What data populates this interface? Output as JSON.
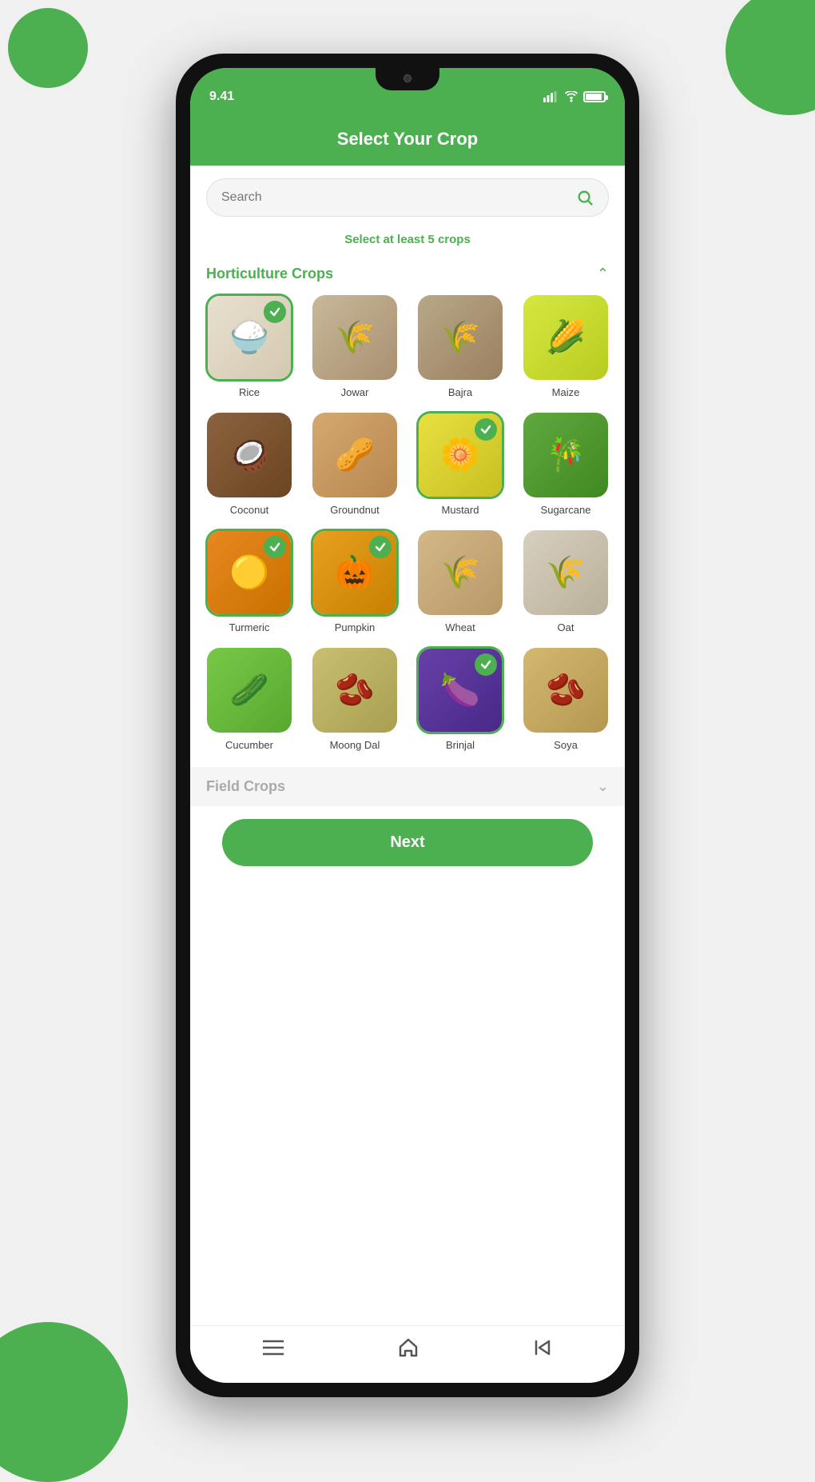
{
  "app": {
    "title": "Select Your Crop",
    "time": "9.41",
    "search_placeholder": "Search",
    "info_text": "Select at least ",
    "info_number": "5",
    "info_text2": " crops"
  },
  "sections": {
    "horticulture": {
      "title": "Horticulture Crops",
      "collapsed": false
    },
    "field": {
      "title": "Field Crops",
      "collapsed": true
    }
  },
  "crops": [
    {
      "id": "rice",
      "name": "Rice",
      "selected": true,
      "emoji": "🍚",
      "imgClass": "img-rice"
    },
    {
      "id": "jowar",
      "name": "Jowar",
      "selected": false,
      "emoji": "🌾",
      "imgClass": "img-jowar"
    },
    {
      "id": "bajra",
      "name": "Bajra",
      "selected": false,
      "emoji": "🌾",
      "imgClass": "img-bajra"
    },
    {
      "id": "maize",
      "name": "Maize",
      "selected": false,
      "emoji": "🌽",
      "imgClass": "img-maize"
    },
    {
      "id": "coconut",
      "name": "Coconut",
      "selected": false,
      "emoji": "🥥",
      "imgClass": "img-coconut"
    },
    {
      "id": "groundnut",
      "name": "Groundnut",
      "selected": false,
      "emoji": "🥜",
      "imgClass": "img-groundnut"
    },
    {
      "id": "mustard",
      "name": "Mustard",
      "selected": true,
      "emoji": "🌼",
      "imgClass": "img-mustard"
    },
    {
      "id": "sugarcane",
      "name": "Sugarcane",
      "selected": false,
      "emoji": "🎋",
      "imgClass": "img-sugarcane"
    },
    {
      "id": "turmeric",
      "name": "Turmeric",
      "selected": true,
      "emoji": "🟡",
      "imgClass": "img-turmeric"
    },
    {
      "id": "pumpkin",
      "name": "Pumpkin",
      "selected": true,
      "emoji": "🎃",
      "imgClass": "img-pumpkin"
    },
    {
      "id": "wheat",
      "name": "Wheat",
      "selected": false,
      "emoji": "🌾",
      "imgClass": "img-wheat"
    },
    {
      "id": "oat",
      "name": "Oat",
      "selected": false,
      "emoji": "🌾",
      "imgClass": "img-oat"
    },
    {
      "id": "cucumber",
      "name": "Cucumber",
      "selected": false,
      "emoji": "🥒",
      "imgClass": "img-cucumber"
    },
    {
      "id": "moongdal",
      "name": "Moong Dal",
      "selected": false,
      "emoji": "🫘",
      "imgClass": "img-moong"
    },
    {
      "id": "brinjal",
      "name": "Brinjal",
      "selected": true,
      "emoji": "🍆",
      "imgClass": "img-brinjal"
    },
    {
      "id": "soya",
      "name": "Soya",
      "selected": false,
      "emoji": "🫘",
      "imgClass": "img-soya"
    }
  ],
  "buttons": {
    "next": "Next"
  },
  "colors": {
    "primary": "#4caf50",
    "text_muted": "#888",
    "text_dark": "#444"
  }
}
